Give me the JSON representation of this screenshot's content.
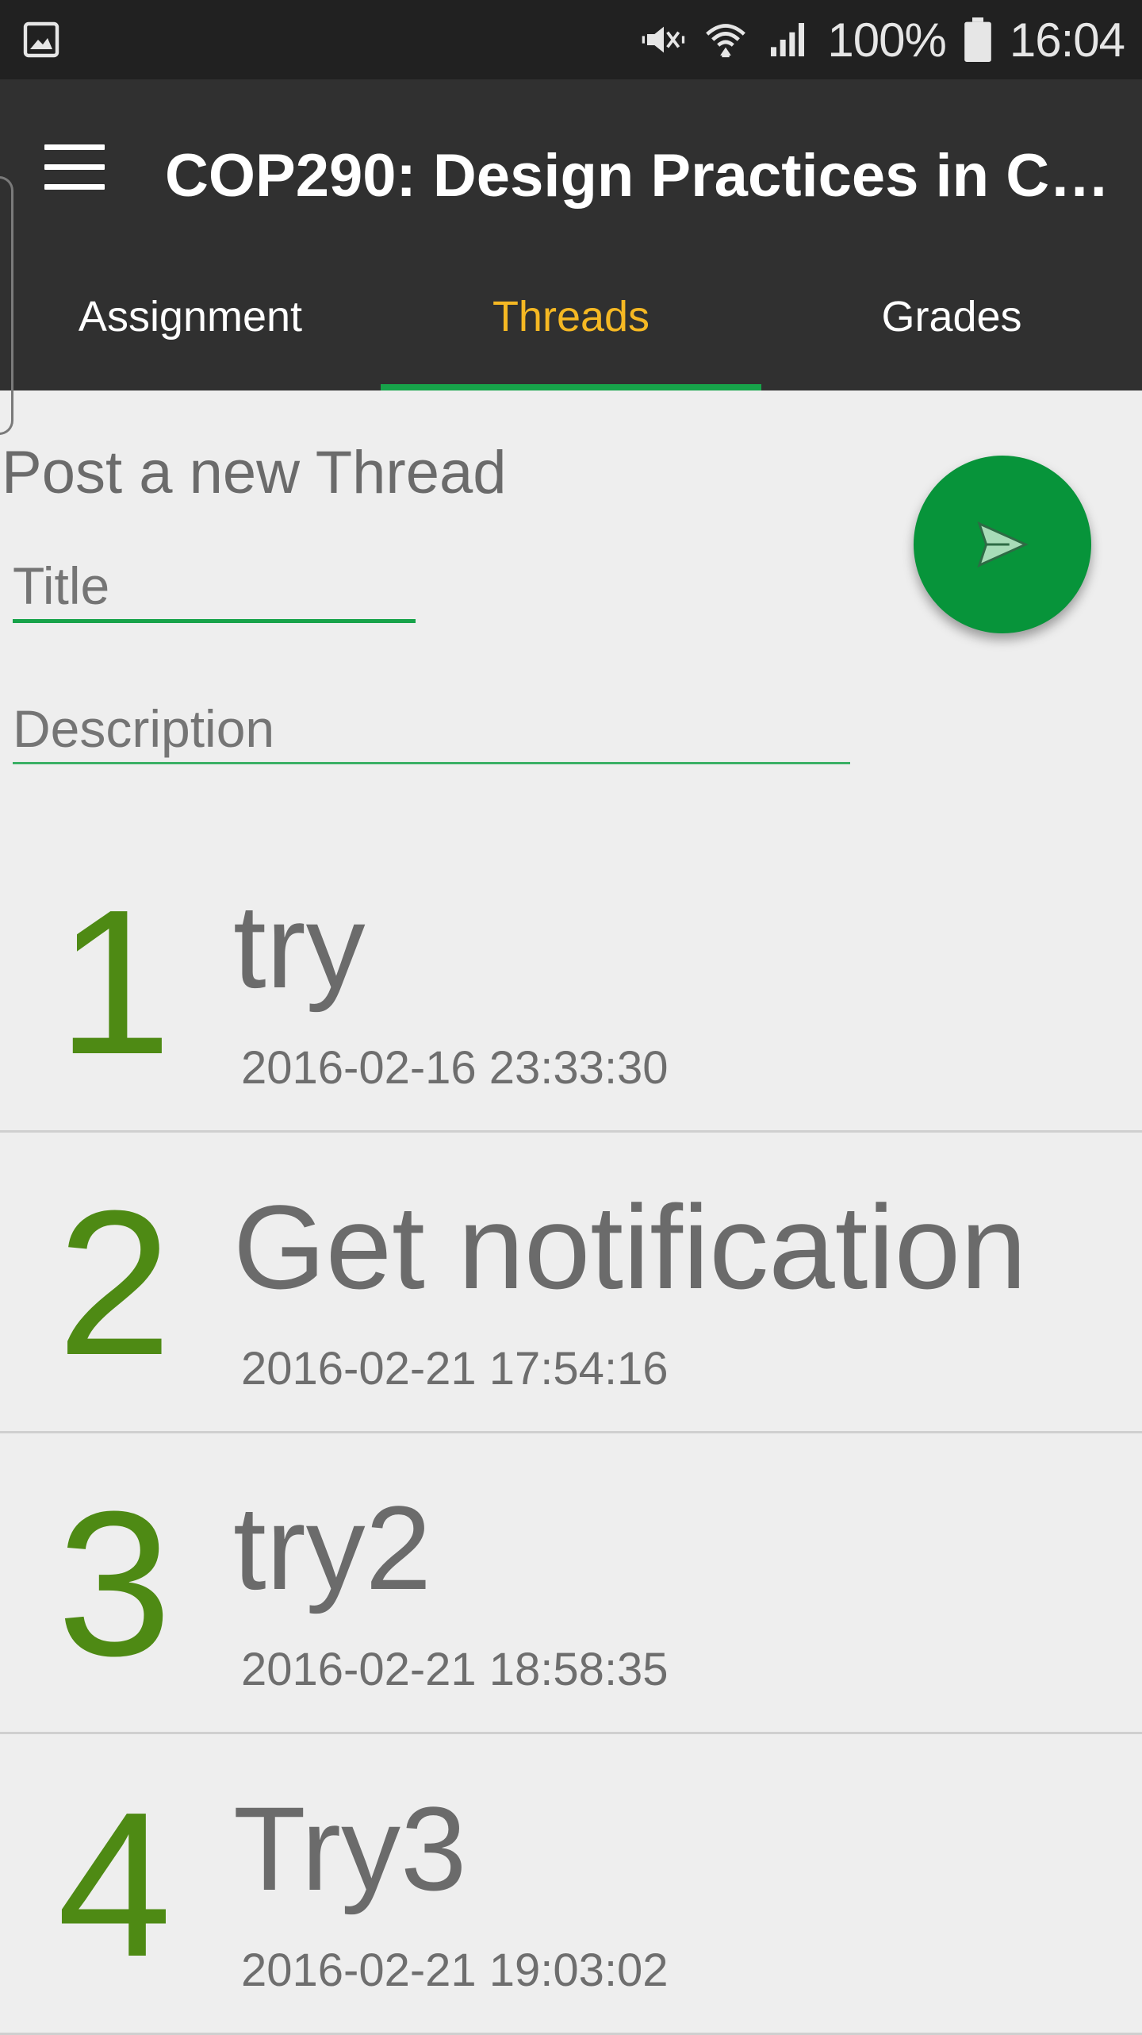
{
  "status_bar": {
    "battery": "100%",
    "time": "16:04",
    "icons": [
      "gallery-icon",
      "mute-vibrate-icon",
      "wifi-icon",
      "signal-icon",
      "battery-icon"
    ]
  },
  "app_bar": {
    "title": "COP290: Design Practices in Co…",
    "menu_icon": "hamburger-menu-icon"
  },
  "tabs": [
    {
      "label": "Assignment",
      "active": false
    },
    {
      "label": "Threads",
      "active": true
    },
    {
      "label": "Grades",
      "active": false
    }
  ],
  "form": {
    "heading": "Post a new Thread",
    "title_placeholder": "Title",
    "description_placeholder": "Description",
    "submit_icon": "send-icon"
  },
  "threads": [
    {
      "number": "1",
      "title": "try",
      "date": "2016-02-16 23:33:30"
    },
    {
      "number": "2",
      "title": "Get notification",
      "date": "2016-02-21 17:54:16"
    },
    {
      "number": "3",
      "title": "try2",
      "date": "2016-02-21 18:58:35"
    },
    {
      "number": "4",
      "title": "Try3",
      "date": "2016-02-21 19:03:02"
    }
  ],
  "colors": {
    "accent_green": "#17a34a",
    "fab_green": "#07943a",
    "active_tab_text": "#f5b823",
    "thread_number": "#4e8a14",
    "app_bar": "#303030",
    "status_bar": "#212121",
    "background": "#eeeeee"
  }
}
